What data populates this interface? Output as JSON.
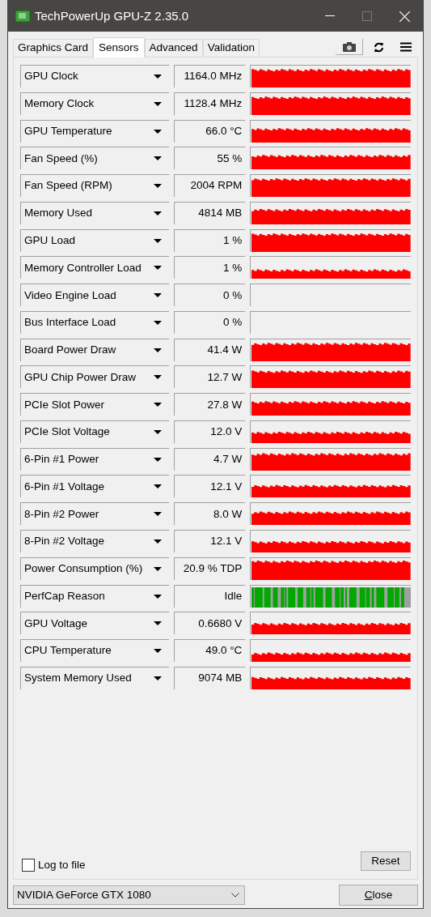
{
  "window": {
    "title": "TechPowerUp GPU-Z 2.35.0"
  },
  "tabs": [
    {
      "label": "Graphics Card",
      "selected": false
    },
    {
      "label": "Sensors",
      "selected": true
    },
    {
      "label": "Advanced",
      "selected": false
    },
    {
      "label": "Validation",
      "selected": false
    }
  ],
  "sensors": [
    {
      "name": "GPU Clock",
      "value": "1164.0 MHz",
      "kind": "graph"
    },
    {
      "name": "Memory Clock",
      "value": "1128.4 MHz",
      "kind": "graph"
    },
    {
      "name": "GPU Temperature",
      "value": "66.0 °C",
      "kind": "graph"
    },
    {
      "name": "Fan Speed (%)",
      "value": "55 %",
      "kind": "graph"
    },
    {
      "name": "Fan Speed (RPM)",
      "value": "2004 RPM",
      "kind": "graph"
    },
    {
      "name": "Memory Used",
      "value": "4814 MB",
      "kind": "graph"
    },
    {
      "name": "GPU Load",
      "value": "1 %",
      "kind": "graph"
    },
    {
      "name": "Memory Controller Load",
      "value": "1 %",
      "kind": "graph"
    },
    {
      "name": "Video Engine Load",
      "value": "0 %",
      "kind": "empty"
    },
    {
      "name": "Bus Interface Load",
      "value": "0 %",
      "kind": "empty"
    },
    {
      "name": "Board Power Draw",
      "value": "41.4 W",
      "kind": "graph"
    },
    {
      "name": "GPU Chip Power Draw",
      "value": "12.7 W",
      "kind": "graph"
    },
    {
      "name": "PCIe Slot Power",
      "value": "27.8 W",
      "kind": "graph"
    },
    {
      "name": "PCIe Slot Voltage",
      "value": "12.0 V",
      "kind": "graph"
    },
    {
      "name": "6-Pin #1 Power",
      "value": "4.7 W",
      "kind": "graph"
    },
    {
      "name": "6-Pin #1 Voltage",
      "value": "12.1 V",
      "kind": "graph"
    },
    {
      "name": "8-Pin #2 Power",
      "value": "8.0 W",
      "kind": "graph"
    },
    {
      "name": "8-Pin #2 Voltage",
      "value": "12.1 V",
      "kind": "graph"
    },
    {
      "name": "Power Consumption (%)",
      "value": "20.9 % TDP",
      "kind": "graph"
    },
    {
      "name": "PerfCap Reason",
      "value": "Idle",
      "kind": "flags"
    },
    {
      "name": "GPU Voltage",
      "value": "0.6680 V",
      "kind": "graph"
    },
    {
      "name": "CPU Temperature",
      "value": "49.0 °C",
      "kind": "graph"
    },
    {
      "name": "System Memory Used",
      "value": "9074 MB",
      "kind": "graph"
    }
  ],
  "log_to_file": {
    "label": "Log to file",
    "checked": false
  },
  "reset_button": "Reset",
  "device_select": {
    "value": "NVIDIA GeForce GTX 1080"
  },
  "close_button": "Close"
}
